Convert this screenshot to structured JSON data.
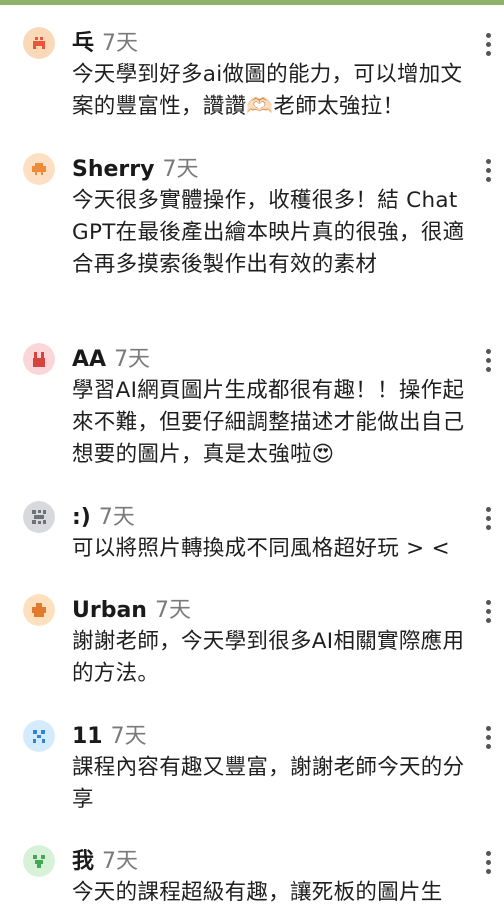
{
  "comments": [
    {
      "name": "乓",
      "time": "7天",
      "text": "今天學到好多ai做圖的能力，可以增加文案的豐富性，讚讚🫶🏻老師太強拉！",
      "avatar_bg": "#f9d9b8",
      "avatar_fg": "#e8553a",
      "avatar_icon": "mascot-icon"
    },
    {
      "name": "Sherry",
      "time": "7天",
      "text": "今天很多實體操作，收穫很多！結 Chat GPT在最後產出繪本映片真的很強，很適合再多摸索後製作出有效的素材",
      "avatar_bg": "#fde0c4",
      "avatar_fg": "#ef8a3a",
      "avatar_icon": "mascot-icon"
    },
    {
      "name": "AA",
      "time": "7天",
      "text": "學習AI網頁圖片生成都很有趣！！操作起來不難，但要仔細調整描述才能做出自己想要的圖片，真是太強啦😍",
      "avatar_bg": "#fad6d8",
      "avatar_fg": "#d6443f",
      "avatar_icon": "mascot-icon"
    },
    {
      "name": ":)",
      "time": "7天",
      "text": "可以將照片轉換成不同風格超好玩 > <",
      "avatar_bg": "#d7d9dc",
      "avatar_fg": "#6e7176",
      "avatar_icon": "mascot-icon"
    },
    {
      "name": "Urban",
      "time": "7天",
      "text": "謝謝老師，今天學到很多AI相關實際應用的方法。",
      "avatar_bg": "#fde1bf",
      "avatar_fg": "#e27a2f",
      "avatar_icon": "mascot-icon"
    },
    {
      "name": "11",
      "time": "7天",
      "text": "課程內容有趣又豐富，謝謝老師今天的分享",
      "avatar_bg": "#d4ebfb",
      "avatar_fg": "#2f84d8",
      "avatar_icon": "mascot-icon"
    },
    {
      "name": "我",
      "time": "7天",
      "text": "今天的課程超級有趣，讓死板的圖片生",
      "avatar_bg": "#d7f2d9",
      "avatar_fg": "#43a954",
      "avatar_icon": "mascot-icon"
    }
  ],
  "colors": {
    "accent_bar": "#8fb369"
  }
}
